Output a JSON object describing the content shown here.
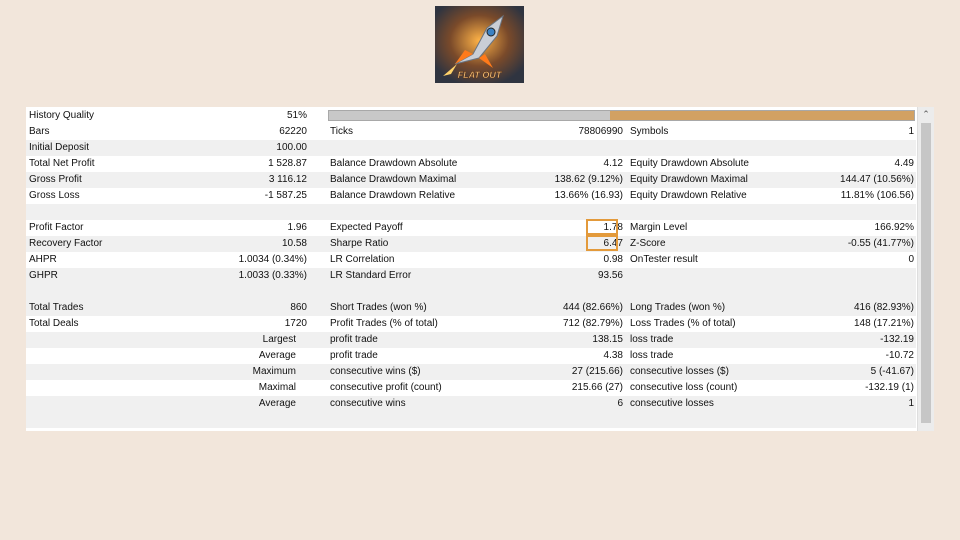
{
  "brand": {
    "logo_text": "FLAT OUT"
  },
  "history": {
    "label": "History Quality",
    "value": "51%",
    "progress": 0.51
  },
  "rows": [
    {
      "c1": "Bars",
      "c2": "62220",
      "c3": "Ticks",
      "c4": "78806990",
      "c5": "Symbols",
      "c6": "1"
    },
    {
      "c1": "Initial Deposit",
      "c2": "100.00",
      "c3": "",
      "c4": "",
      "c5": "",
      "c6": ""
    },
    {
      "c1": "Total Net Profit",
      "c2": "1 528.87",
      "c3": "Balance Drawdown Absolute",
      "c4": "4.12",
      "c5": "Equity Drawdown Absolute",
      "c6": "4.49"
    },
    {
      "c1": "Gross Profit",
      "c2": "3 116.12",
      "c3": "Balance Drawdown Maximal",
      "c4": "138.62 (9.12%)",
      "c5": "Equity Drawdown Maximal",
      "c6": "144.47 (10.56%)"
    },
    {
      "c1": "Gross Loss",
      "c2": "-1 587.25",
      "c3": "Balance Drawdown Relative",
      "c4": "13.66% (16.93)",
      "c5": "Equity Drawdown Relative",
      "c6": "11.81% (106.56)"
    },
    {
      "blank": true
    },
    {
      "c1": "Profit Factor",
      "c2": "1.96",
      "c3": "Expected Payoff",
      "c4": "1.78",
      "c5": "Margin Level",
      "c6": "166.92%",
      "hl": true
    },
    {
      "c1": "Recovery Factor",
      "c2": "10.58",
      "c3": "Sharpe Ratio",
      "c4": "6.47",
      "c5": "Z-Score",
      "c6": "-0.55 (41.77%)",
      "hl": true
    },
    {
      "c1": "AHPR",
      "c2": "1.0034 (0.34%)",
      "c3": "LR Correlation",
      "c4": "0.98",
      "c5": "OnTester result",
      "c6": "0"
    },
    {
      "c1": "GHPR",
      "c2": "1.0033 (0.33%)",
      "c3": "LR Standard Error",
      "c4": "93.56",
      "c5": "",
      "c6": ""
    },
    {
      "blank": true
    },
    {
      "c1": "Total Trades",
      "c2": "860",
      "c3": "Short Trades (won %)",
      "c4": "444 (82.66%)",
      "c5": "Long Trades (won %)",
      "c6": "416 (82.93%)"
    },
    {
      "c1": "Total Deals",
      "c2": "1720",
      "c3": "Profit Trades (% of total)",
      "c4": "712 (82.79%)",
      "c5": "Loss Trades (% of total)",
      "c6": "148 (17.21%)"
    },
    {
      "c1": "Largest",
      "c1_align": "right",
      "c2": "",
      "c3": "profit trade",
      "c4": "138.15",
      "c5": "loss trade",
      "c6": "-132.19"
    },
    {
      "c1": "Average",
      "c1_align": "right",
      "c2": "",
      "c3": "profit trade",
      "c4": "4.38",
      "c5": "loss trade",
      "c6": "-10.72"
    },
    {
      "c1": "Maximum",
      "c1_align": "right",
      "c2": "",
      "c3": "consecutive wins ($)",
      "c4": "27 (215.66)",
      "c5": "consecutive losses ($)",
      "c6": "5 (-41.67)"
    },
    {
      "c1": "Maximal",
      "c1_align": "right",
      "c2": "",
      "c3": "consecutive profit (count)",
      "c4": "215.66 (27)",
      "c5": "consecutive loss (count)",
      "c6": "-132.19 (1)"
    },
    {
      "c1": "Average",
      "c1_align": "right",
      "c2": "",
      "c3": "consecutive wins",
      "c4": "6",
      "c5": "consecutive losses",
      "c6": "1"
    },
    {
      "blank": true
    }
  ],
  "colors": {
    "background": "#f2e6db",
    "highlight": "#e39a3b",
    "quality_fill": "#d2a163"
  },
  "icons": {
    "scroll_up": "chevron-up-icon"
  }
}
